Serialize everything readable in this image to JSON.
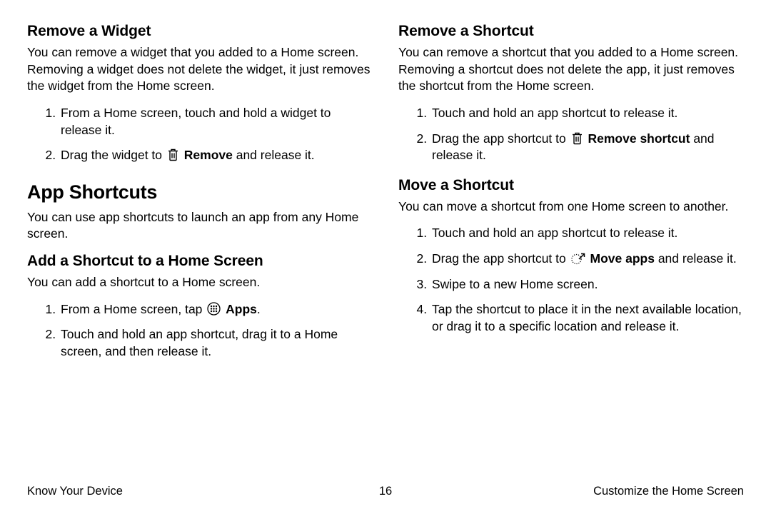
{
  "left": {
    "removeWidget": {
      "heading": "Remove a Widget",
      "intro": "You can remove a widget that you added to a Home screen. Removing a widget does not delete the widget, it just removes the widget from the Home screen.",
      "step1": "From a Home screen, touch and hold a widget to release it.",
      "step2a": "Drag the widget to ",
      "step2bold": "Remove",
      "step2b": " and release it."
    },
    "appShortcuts": {
      "heading": "App Shortcuts",
      "intro": "You can use app shortcuts to launch an app from any Home screen."
    },
    "addShortcut": {
      "heading": "Add a Shortcut to a Home Screen",
      "intro": "You can add a shortcut to a Home screen.",
      "step1a": "From a Home screen, tap ",
      "step1bold": "Apps",
      "step1b": ".",
      "step2": "Touch and hold an app shortcut, drag it to a Home screen, and then release it."
    }
  },
  "right": {
    "removeShortcut": {
      "heading": "Remove a Shortcut",
      "intro": "You can remove a shortcut that you added to a Home screen. Removing a shortcut does not delete the app, it just removes the shortcut from the Home screen.",
      "step1": "Touch and hold an app shortcut to release it.",
      "step2a": "Drag the app shortcut to ",
      "step2bold": "Remove shortcut",
      "step2b": " and release it."
    },
    "moveShortcut": {
      "heading": "Move a Shortcut",
      "intro": "You can move a shortcut from one Home screen to another.",
      "step1": "Touch and hold an app shortcut to release it.",
      "step2a": "Drag the app shortcut to ",
      "step2bold": "Move apps",
      "step2b": " and release it.",
      "step3": "Swipe to a new Home screen.",
      "step4": "Tap the shortcut to place it in the next available location, or drag it to a specific location and release it."
    }
  },
  "footer": {
    "left": "Know Your Device",
    "page": "16",
    "right": "Customize the Home Screen"
  }
}
